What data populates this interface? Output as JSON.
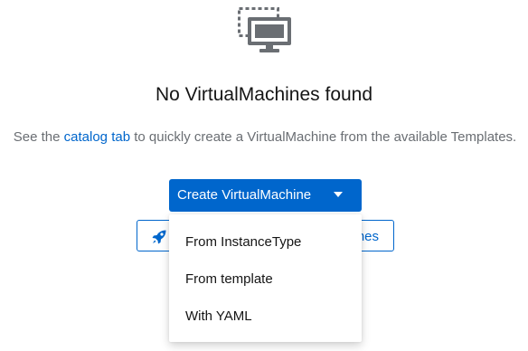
{
  "empty_state": {
    "icon": "virtual-machine-icon",
    "title": "No VirtualMachines found",
    "body_prefix": "See the ",
    "catalog_link": "catalog tab",
    "body_suffix": " to quickly create a VirtualMachine from the available Templates."
  },
  "create_button": {
    "label": "Create VirtualMachine",
    "icon": "caret-down-icon"
  },
  "secondary_button": {
    "icon": "rocket-icon",
    "label_visible": "nes"
  },
  "dropdown": {
    "items": [
      {
        "label": "From InstanceType"
      },
      {
        "label": "From template"
      },
      {
        "label": "With YAML"
      }
    ]
  },
  "colors": {
    "primary": "#0066cc",
    "icon_gray": "#6a6e73",
    "text": "#151515"
  }
}
